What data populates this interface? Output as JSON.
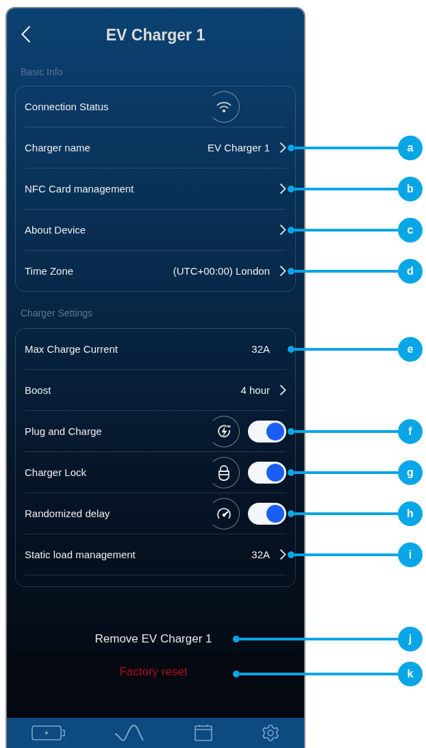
{
  "header": {
    "title": "EV Charger 1"
  },
  "sections": [
    {
      "title": "Basic Info",
      "rows": [
        {
          "kind": "status",
          "label": "Connection Status"
        },
        {
          "kind": "link",
          "label": "Charger name",
          "value": "EV Charger 1",
          "callout": "a"
        },
        {
          "kind": "link",
          "label": "NFC Card management",
          "callout": "b"
        },
        {
          "kind": "link",
          "label": "About Device",
          "callout": "c"
        },
        {
          "kind": "link",
          "label": "Time Zone",
          "value": "(UTC+00:00) London",
          "callout": "d"
        }
      ]
    },
    {
      "title": "Charger Settings",
      "rows": [
        {
          "kind": "value",
          "label": "Max Charge Current",
          "value": "32A",
          "callout": "e"
        },
        {
          "kind": "link",
          "label": "Boost",
          "value": "4 hour"
        },
        {
          "kind": "toggle",
          "label": "Plug and Charge",
          "on": true,
          "callout": "f"
        },
        {
          "kind": "toggle",
          "label": "Charger Lock",
          "on": true,
          "callout": "g"
        },
        {
          "kind": "toggle",
          "label": "Randomized delay",
          "on": true,
          "callout": "h"
        },
        {
          "kind": "link",
          "label": "Static load management",
          "value": "32A",
          "callout": "i"
        }
      ]
    }
  ],
  "remove": {
    "label": "Remove EV Charger 1",
    "callout": "j"
  },
  "factory_reset": {
    "label": "Factory reset",
    "callout": "k"
  }
}
